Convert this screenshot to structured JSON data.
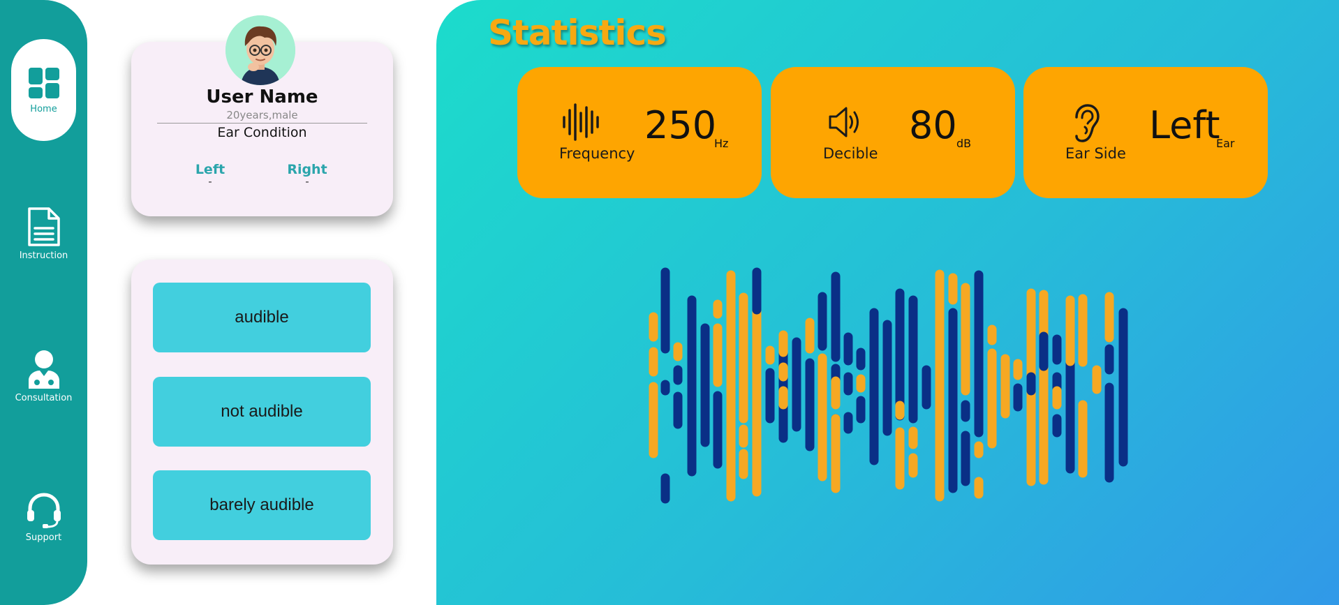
{
  "sidebar": {
    "items": [
      {
        "label": "Home",
        "icon": "dashboard-icon",
        "active": true
      },
      {
        "label": "Instruction",
        "icon": "document-icon",
        "active": false
      },
      {
        "label": "Consultation",
        "icon": "doctor-icon",
        "active": false
      },
      {
        "label": "Support",
        "icon": "headset-icon",
        "active": false
      }
    ]
  },
  "profile": {
    "name": "User Name",
    "meta": "20years,male",
    "condition_label": "Ear Condition",
    "left_label": "Left",
    "left_value": "-",
    "right_label": "Right",
    "right_value": "-"
  },
  "responses": {
    "audible": "audible",
    "not_audible": "not audible",
    "barely_audible": "barely audible"
  },
  "stats": {
    "title": "Statistics",
    "frequency": {
      "label": "Frequency",
      "value": "250",
      "unit": "Hz"
    },
    "decibel": {
      "label": "Decible",
      "value": "80",
      "unit": "dB"
    },
    "ear_side": {
      "label": "Ear Side",
      "value": "Left",
      "unit": "Ear"
    }
  },
  "colors": {
    "sidebar": "#129e9b",
    "accent_orange": "#fea501",
    "title": "#f7a912",
    "wave_blue": "#0a2f86",
    "wave_orange": "#f6a823",
    "button": "#42cfde"
  }
}
